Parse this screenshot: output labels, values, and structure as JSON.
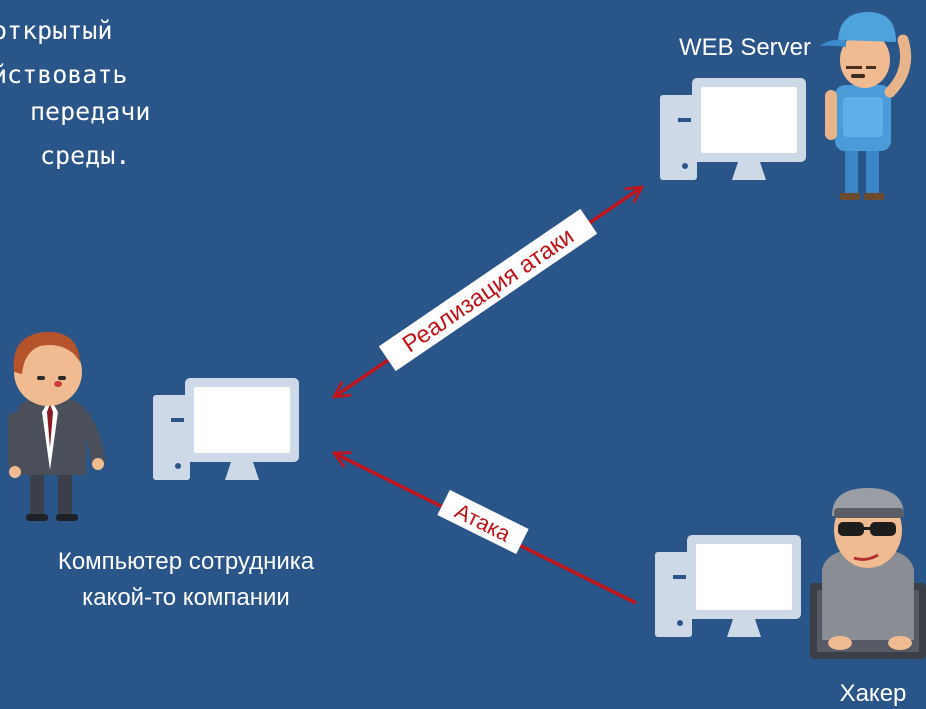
{
  "intro_text": {
    "lines": [
      "открытый",
      "йствовать",
      "передачи",
      "среды."
    ]
  },
  "nodes": {
    "web_server": {
      "label": "WEB Server"
    },
    "employee": {
      "label_line1": "Компьютер сотрудника",
      "label_line2": "какой-то компании"
    },
    "hacker": {
      "label": "Хакер"
    }
  },
  "edges": {
    "attack_realization": {
      "label": "Реализация атаки"
    },
    "attack": {
      "label": "Атака"
    }
  },
  "colors": {
    "background": "#2a5588",
    "computer": "#cdd9e6",
    "computer_screen": "#ffffff",
    "arrow": "#c0141c",
    "text": "#ffffff"
  }
}
